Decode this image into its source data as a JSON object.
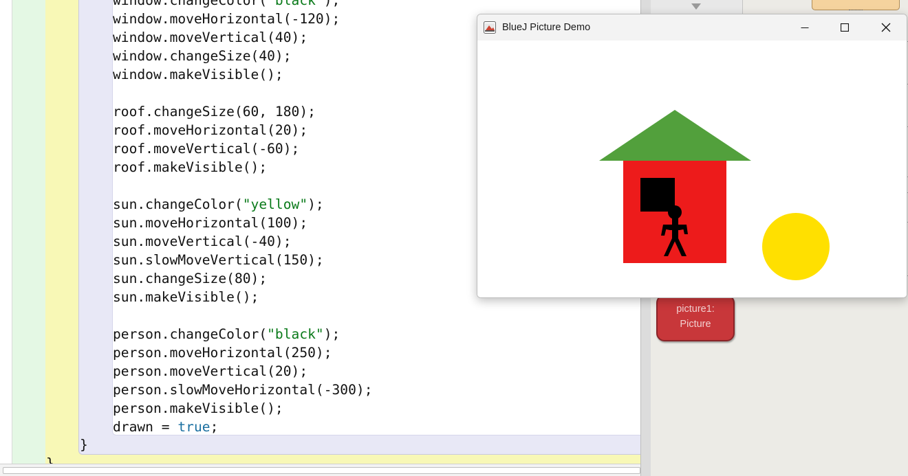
{
  "editor": {
    "lines": [
      [
        {
          "t": "window.changeColor("
        },
        {
          "t": "\"black\"",
          "c": "str"
        },
        {
          "t": ");"
        }
      ],
      [
        {
          "t": "window.moveHorizontal(-120);"
        }
      ],
      [
        {
          "t": "window.moveVertical(40);"
        }
      ],
      [
        {
          "t": "window.changeSize(40);"
        }
      ],
      [
        {
          "t": "window.makeVisible();"
        }
      ],
      [],
      [
        {
          "t": "roof.changeSize(60, 180);"
        }
      ],
      [
        {
          "t": "roof.moveHorizontal(20);"
        }
      ],
      [
        {
          "t": "roof.moveVertical(-60);"
        }
      ],
      [
        {
          "t": "roof.makeVisible();"
        }
      ],
      [],
      [
        {
          "t": "sun.changeColor("
        },
        {
          "t": "\"yellow\"",
          "c": "str"
        },
        {
          "t": ");"
        }
      ],
      [
        {
          "t": "sun.moveHorizontal(100);"
        }
      ],
      [
        {
          "t": "sun.moveVertical(-40);"
        }
      ],
      [
        {
          "t": "sun.slowMoveVertical(150);"
        }
      ],
      [
        {
          "t": "sun.changeSize(80);"
        }
      ],
      [
        {
          "t": "sun.makeVisible();"
        }
      ],
      [],
      [
        {
          "t": "person.changeColor("
        },
        {
          "t": "\"black\"",
          "c": "str"
        },
        {
          "t": ");"
        }
      ],
      [
        {
          "t": "person.moveHorizontal(250);"
        }
      ],
      [
        {
          "t": "person.moveVertical(20);"
        }
      ],
      [
        {
          "t": "person.slowMoveHorizontal(-300);"
        }
      ],
      [
        {
          "t": "person.makeVisible();"
        }
      ],
      [
        {
          "t": "drawn = "
        },
        {
          "t": "true",
          "c": "kw"
        },
        {
          "t": ";"
        }
      ]
    ],
    "inner_close_brace": "}",
    "outer_close_brace": "}"
  },
  "side_panel": {
    "class_box": {
      "line1": "picture1:",
      "line2": "Picture"
    }
  },
  "window": {
    "title": "BlueJ Picture Demo",
    "icons": {
      "app": "bluej-app-icon",
      "minimize": "minimize-icon",
      "maximize": "maximize-icon",
      "close": "close-icon"
    }
  },
  "picture": {
    "wall_color": "#ed1b1b",
    "roof_color": "#52a03c",
    "window_color": "#000000",
    "sun_color": "#ffe000",
    "person_color": "#000000"
  }
}
